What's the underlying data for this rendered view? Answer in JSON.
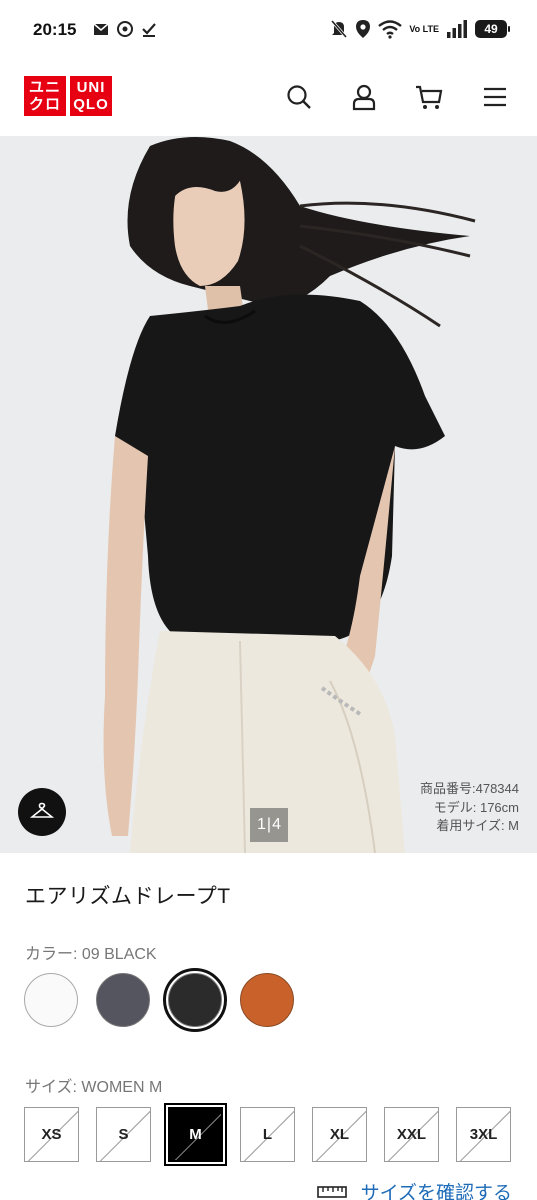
{
  "status_bar": {
    "time": "20:15",
    "battery": "49",
    "network": "Vo LTE",
    "icons": [
      "mail-icon",
      "vpn-icon",
      "download-done-icon",
      "mute-icon",
      "location-icon",
      "wifi-icon",
      "signal-icon",
      "battery-icon"
    ]
  },
  "header": {
    "logo_top": "ユニクロ",
    "logo_brand": "UNIQLO",
    "logo_left_1": "ユニ",
    "logo_left_2": "クロ",
    "logo_right_1": "UNI",
    "logo_right_2": "QLO",
    "icons": [
      "search-icon",
      "account-icon",
      "cart-icon",
      "menu-icon"
    ]
  },
  "hero": {
    "pager_current": "1",
    "pager_total": "4",
    "product_number": "商品番号:478344",
    "model": "モデル: 176cm",
    "worn_size": "着用サイズ: M"
  },
  "product": {
    "title": "エアリズムドレープT",
    "color_label": "カラー: 09 BLACK",
    "colors": [
      {
        "name": "white",
        "hex": "#fafafa"
      },
      {
        "name": "gray",
        "hex": "#55555f"
      },
      {
        "name": "black",
        "hex": "#2b2b2b",
        "selected": true
      },
      {
        "name": "orange",
        "hex": "#c8622a"
      }
    ],
    "size_label": "サイズ: WOMEN M",
    "sizes": [
      {
        "label": "XS",
        "selected": false
      },
      {
        "label": "S",
        "selected": false
      },
      {
        "label": "M",
        "selected": true
      },
      {
        "label": "L",
        "selected": false
      },
      {
        "label": "XL",
        "selected": false
      },
      {
        "label": "XXL",
        "selected": false
      },
      {
        "label": "3XL",
        "selected": false
      }
    ],
    "size_check_link": "サイズを確認する"
  },
  "colors": {
    "brand_red": "#e60012",
    "link_blue": "#1e6bb8"
  }
}
